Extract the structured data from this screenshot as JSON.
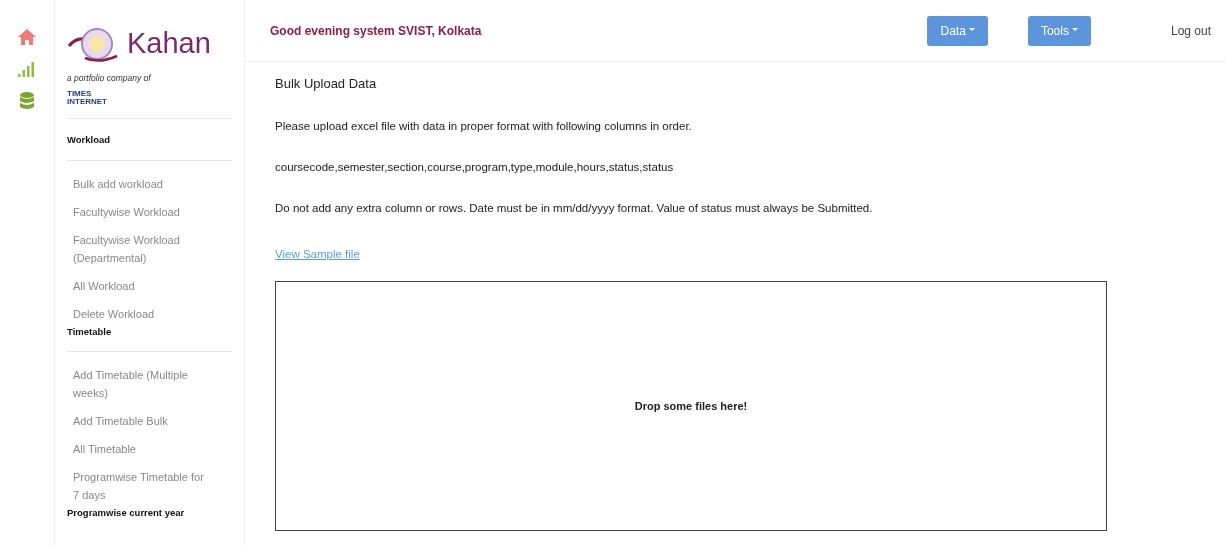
{
  "rail": [
    {
      "kind": "home"
    },
    {
      "kind": "signal"
    },
    {
      "kind": "database"
    }
  ],
  "brand": {
    "name": "Kahan",
    "tagline": "a portfolio company of",
    "parent_lines": [
      "TIMES",
      "INTERNET"
    ]
  },
  "sidebar": {
    "sections": [
      {
        "heading": "Workload",
        "items": [
          "Bulk add workload",
          "Facultywise Workload",
          "Facultywise Workload (Departmental)",
          "All Workload",
          "Delete Workload"
        ]
      },
      {
        "heading": "Timetable",
        "items": [
          "Add Timetable (Multiple weeks)",
          "Add Timetable Bulk",
          "All Timetable",
          "Programwise Timetable for 7 days"
        ]
      },
      {
        "heading": "Programwise current year"
      }
    ]
  },
  "header": {
    "greeting": "Good evening system SVIST, Kolkata",
    "menus": [
      "Data",
      "Tools"
    ],
    "logout": "Log out"
  },
  "page": {
    "title": "Bulk Upload Data",
    "paragraphs": [
      "Please upload excel file with data in proper format with following columns in order.",
      "coursecode,semester,section,course,program,type,module,hours,status,status",
      "Do not add any extra column or rows. Date must be in mm/dd/yyyy format. Value of status must always be Submitted."
    ],
    "sample_link": "View Sample file",
    "dropzone": "Drop some files here!"
  }
}
